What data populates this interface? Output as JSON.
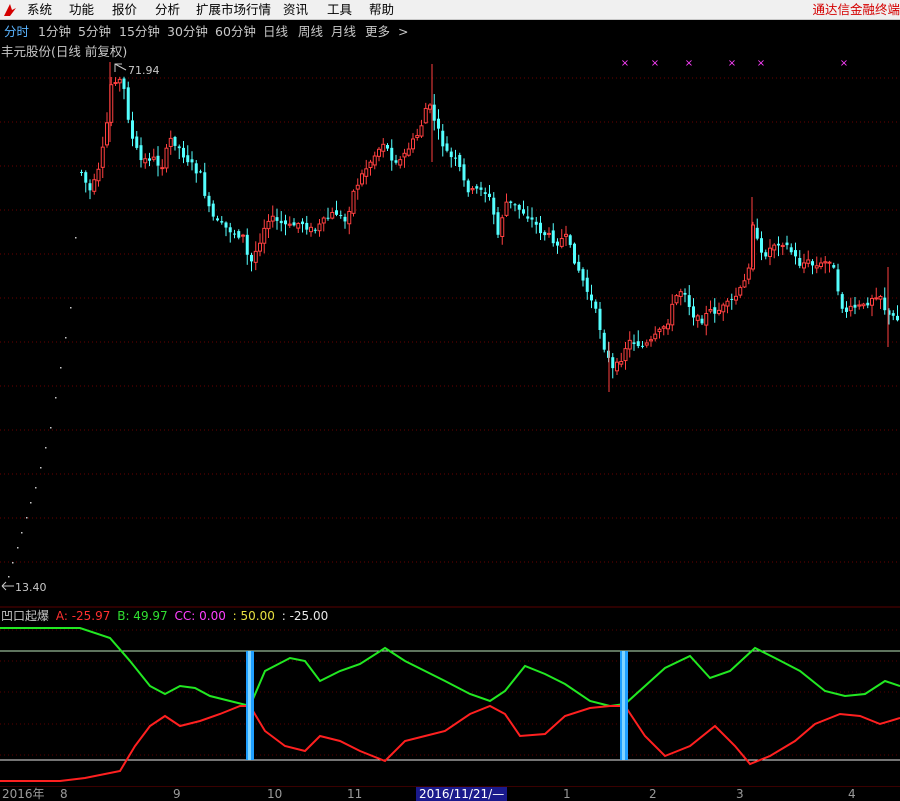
{
  "menubar": {
    "items": [
      "系统",
      "功能",
      "报价",
      "分析",
      "扩展市场行情",
      "资讯",
      "工具",
      "帮助"
    ],
    "brand": "通达信金融终端"
  },
  "periods": {
    "items": [
      "分时",
      "1分钟",
      "5分钟",
      "15分钟",
      "30分钟",
      "60分钟",
      "日线",
      "周线",
      "月线",
      "更多",
      ">"
    ],
    "active": "分时"
  },
  "stock": {
    "title": "丰元股份(日线 前复权)",
    "high_label": "71.94",
    "low_label": "13.40"
  },
  "indicator": {
    "name": "凹口起爆",
    "a_label": "A: -25.97",
    "b_label": "B: 49.97",
    "cc_label": "CC: 0.00",
    "d_label": ": 50.00",
    "e_label": ": -25.00"
  },
  "xaxis": {
    "year_label": "2016年",
    "months": [
      "8",
      "9",
      "10",
      "11",
      "1",
      "2",
      "3",
      "4"
    ],
    "highlight_date": "2016/11/21/—"
  },
  "colors": {
    "up": "#ff4040",
    "down": "#54ffff",
    "line_a": "#ff2020",
    "line_b": "#22e822",
    "cc": "#ff40ff",
    "signal": "#1f9fff",
    "brand": "#d40000"
  },
  "chart_data": {
    "type": "candlestick",
    "price_high": 71.94,
    "price_low": 13.4,
    "signal_marks": 6,
    "buy_bars": 2,
    "indicator_levels": {
      "upper": 50,
      "lower": -25
    }
  }
}
